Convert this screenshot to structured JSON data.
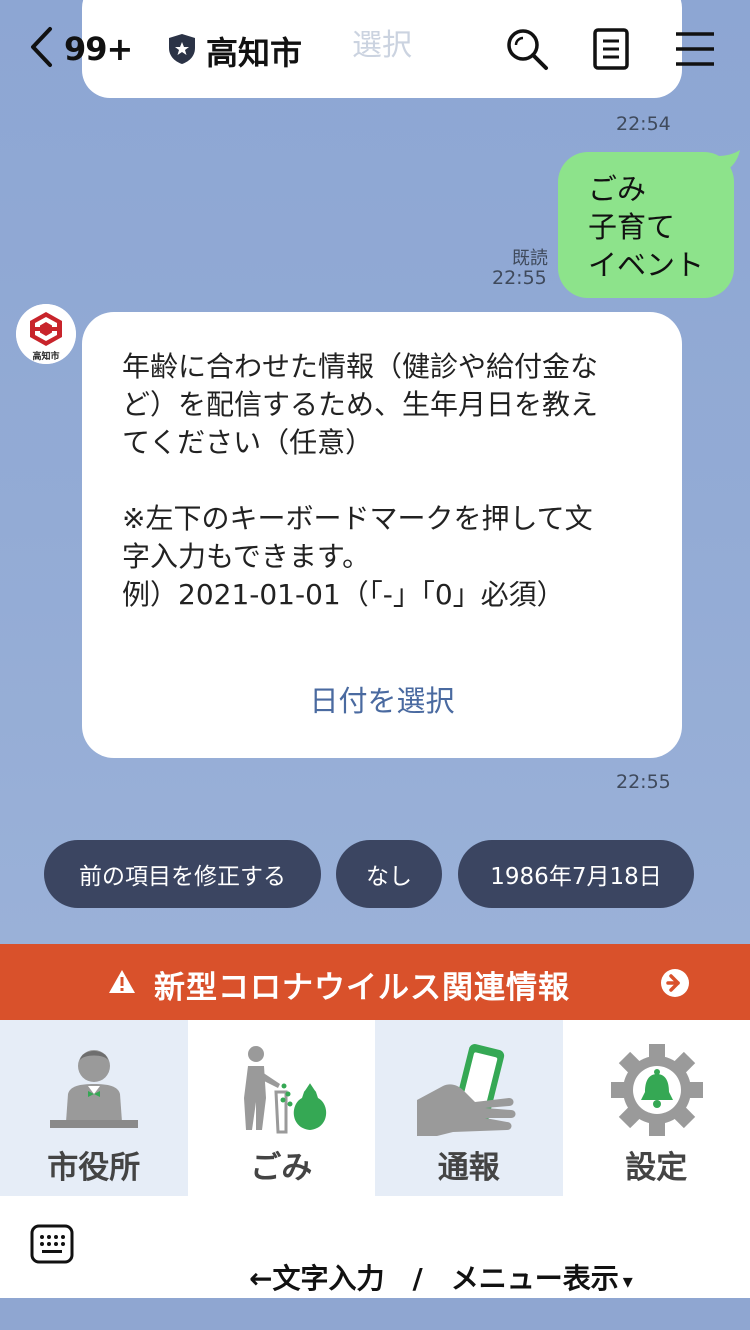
{
  "header": {
    "back_count": "99+",
    "title": "高知市",
    "icons": [
      "chevron-left-icon",
      "shield-icon",
      "search-icon",
      "note-icon",
      "menu-icon"
    ]
  },
  "chat": {
    "prev_message": {
      "button_label": "選択",
      "time": "22:54"
    },
    "sent_message": {
      "lines": [
        "ごみ",
        "子育て",
        "イベント"
      ],
      "read": "既読",
      "time": "22:55"
    },
    "received_message": {
      "avatar_label": "高知市",
      "text": "年齢に合わせた情報（健診や給付金な\nど）を配信するため、生年月日を教え\nてください（任意）\n\n※左下のキーボードマークを押して文\n字入力もできます。\n例）2021-01-01（「-」「0」必須）",
      "action_label": "日付を選択",
      "time": "22:55"
    },
    "quick_replies": [
      "前の項目を修正する",
      "なし",
      "1986年7月18日"
    ]
  },
  "banner": {
    "text": "新型コロナウイルス関連情報"
  },
  "rich_menu": {
    "items": [
      {
        "label": "市役所",
        "icon": "city-hall-staff-icon"
      },
      {
        "label": "ごみ",
        "icon": "garbage-disposal-icon"
      },
      {
        "label": "通報",
        "icon": "phone-report-icon"
      },
      {
        "label": "設定",
        "icon": "settings-bell-icon"
      }
    ]
  },
  "bottom_bar": {
    "toggle_text": "←文字入力　/　メニュー表示",
    "toggle_marker": "▾"
  },
  "colors": {
    "chat_bg": "#8fa6d1",
    "sent_bubble": "#8de38b",
    "quick_reply_bg": "#3b4561",
    "banner_bg": "#d9512b",
    "menu_alt_bg": "#e6edf7",
    "action_link": "#4a6aa0"
  }
}
